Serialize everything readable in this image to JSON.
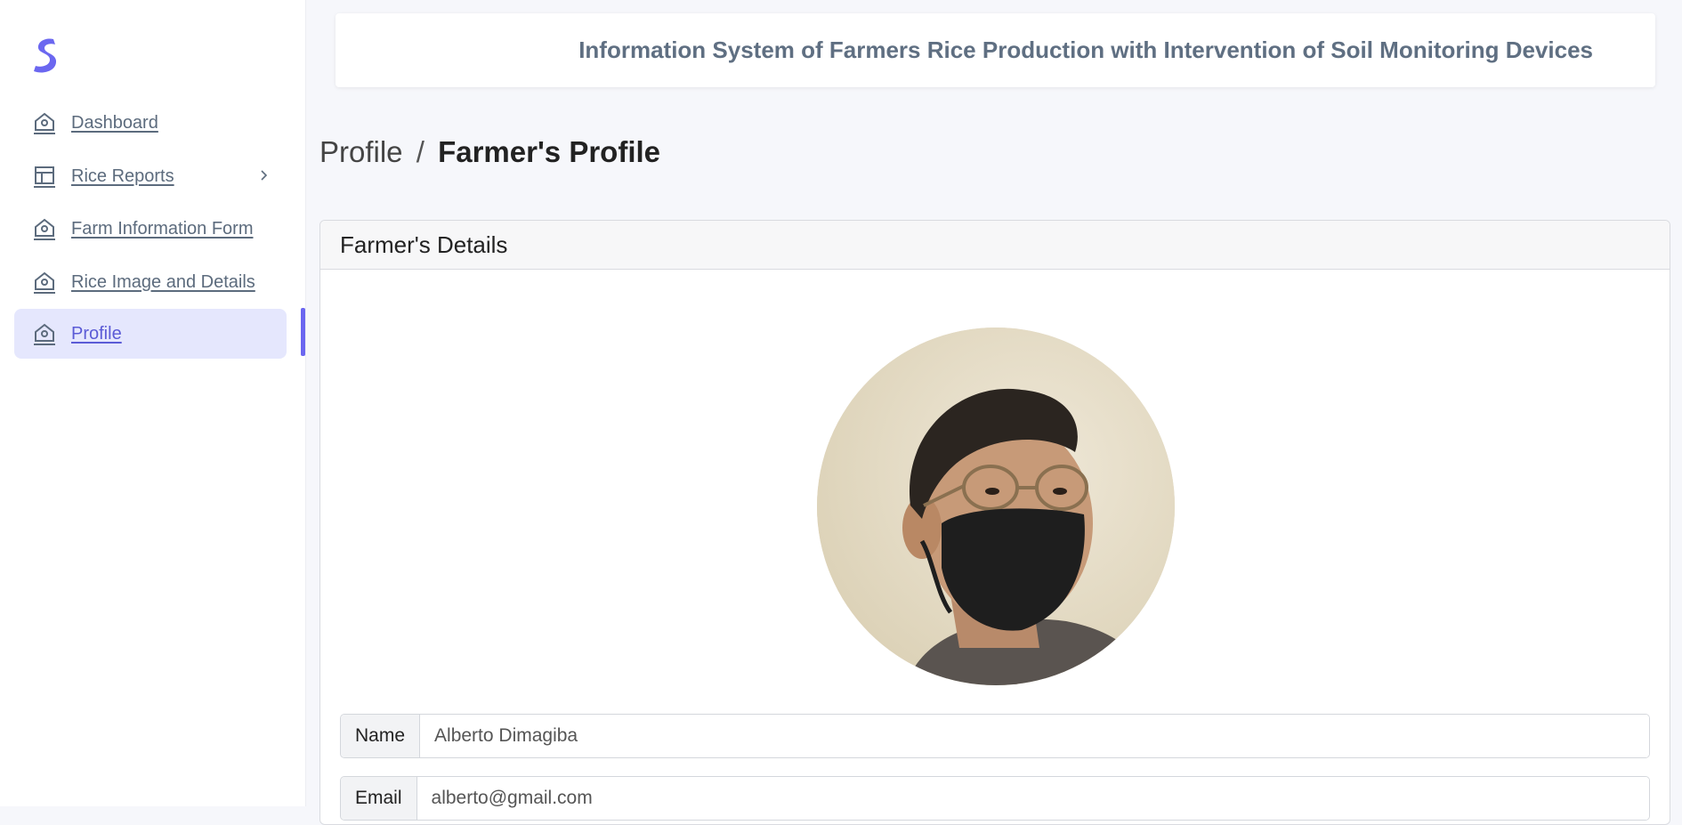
{
  "header": {
    "title": "Information System of Farmers Rice Production with Intervention of Soil Monitoring Devices"
  },
  "sidebar": {
    "logo": "s-logo-icon",
    "items": [
      {
        "label": "Dashboard",
        "icon": "home-icon",
        "active": false
      },
      {
        "label": "Rice Reports",
        "icon": "layout-icon",
        "active": false,
        "has_submenu": true
      },
      {
        "label": "Farm Information Form",
        "icon": "home-icon",
        "active": false
      },
      {
        "label": "Rice Image and Details",
        "icon": "home-icon",
        "active": false
      },
      {
        "label": "Profile",
        "icon": "home-icon",
        "active": true
      }
    ]
  },
  "breadcrumb": {
    "parent": "Profile",
    "separator": "/",
    "current": "Farmer's Profile"
  },
  "details": {
    "title": "Farmer's Details",
    "fields": [
      {
        "label": "Name",
        "value": "Alberto Dimagiba"
      },
      {
        "label": "Email",
        "value": "alberto@gmail.com"
      }
    ]
  },
  "colors": {
    "accent": "#6b67f0",
    "active_bg": "#e5e7fd",
    "nav_text": "#5c6b7d",
    "header_text": "#5f6f82"
  }
}
